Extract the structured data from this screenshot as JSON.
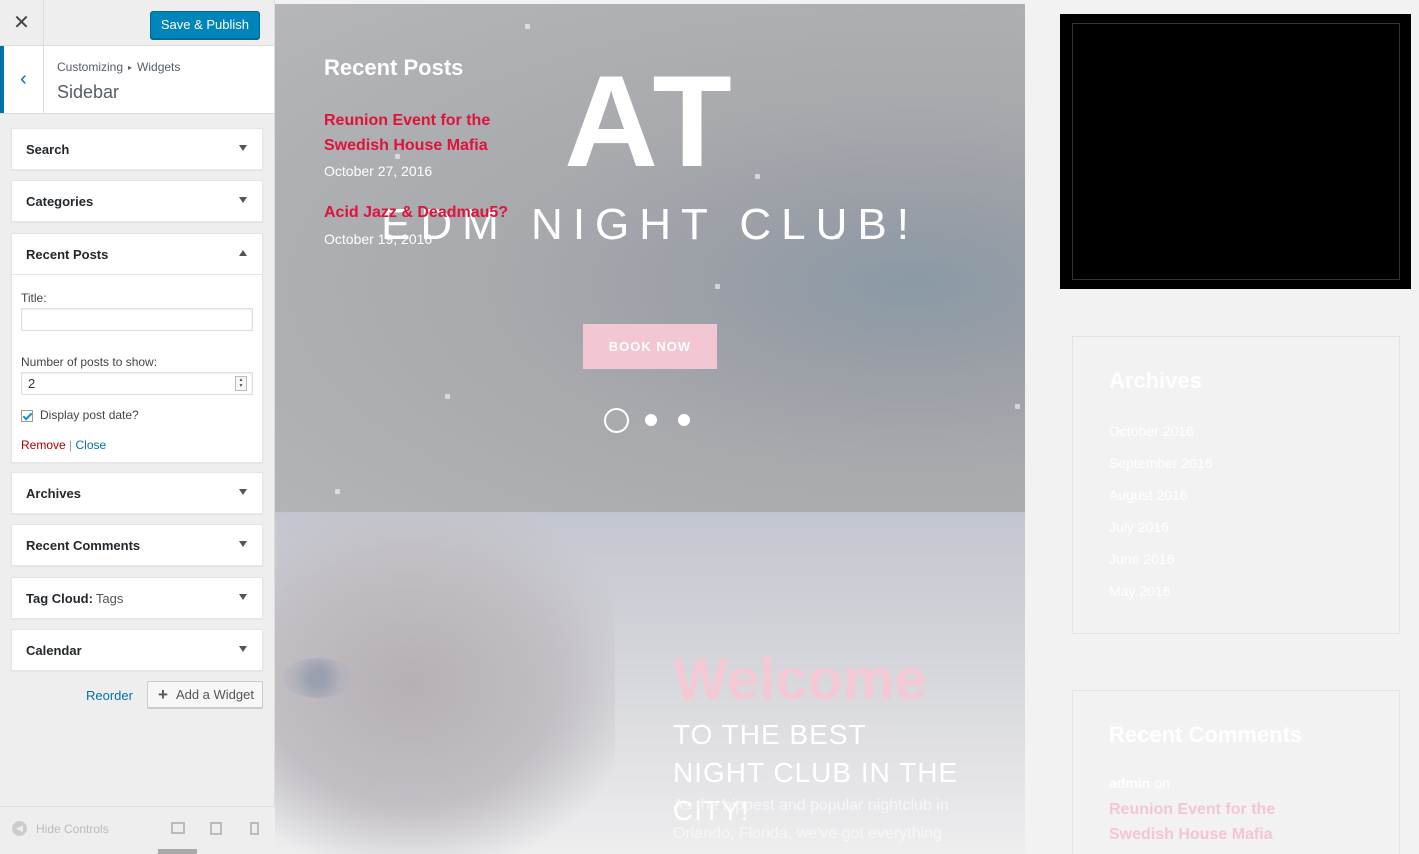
{
  "panel": {
    "close_icon": "close-icon",
    "publish_label": "Save & Publish",
    "back_icon": "chevron-left-icon",
    "breadcrumb": {
      "root": "Customizing",
      "separator": "▸",
      "current": "Widgets"
    },
    "section_title": "Sidebar",
    "widgets": [
      {
        "title": "Search",
        "sub": "",
        "expanded": false
      },
      {
        "title": "Categories",
        "sub": "",
        "expanded": false
      },
      {
        "title": "Recent Posts",
        "sub": "",
        "expanded": true
      },
      {
        "title": "Archives",
        "sub": "",
        "expanded": false
      },
      {
        "title": "Recent Comments",
        "sub": "",
        "expanded": false
      },
      {
        "title": "Tag Cloud:",
        "sub": "Tags",
        "expanded": false
      },
      {
        "title": "Calendar",
        "sub": "",
        "expanded": false
      }
    ],
    "recent_posts_form": {
      "title_label": "Title:",
      "title_value": "",
      "number_label": "Number of posts to show:",
      "number_value": "2",
      "display_date_label": "Display post date?",
      "display_date_checked": true,
      "remove_label": "Remove",
      "divider": "|",
      "close_label": "Close"
    },
    "reorder_label": "Reorder",
    "add_widget_label": "Add a Widget",
    "hide_controls_label": "Hide Controls",
    "devices": [
      "desktop-icon",
      "tablet-icon",
      "mobile-icon"
    ]
  },
  "preview": {
    "hero_big": "AT",
    "hero_sub": "EDM NIGHT CLUB!",
    "book_label": "BOOK NOW",
    "slider_dots": 3,
    "welcome": "Welcome",
    "tagline": "TO THE BEST NIGHT CLUB IN THE CITY!",
    "intro": "As the hippest and popular nightclub in Orlando, Florida, we've got everything",
    "sidebar": {
      "recent_posts_title": "Recent Posts",
      "posts": [
        {
          "title": "Reunion Event for the Swedish House Mafia",
          "date": "October 27, 2016"
        },
        {
          "title": "Acid Jazz & Deadmau5?",
          "date": "October 19, 2016"
        }
      ],
      "archives_title": "Archives",
      "archives": [
        "October 2016",
        "September 2016",
        "August 2016",
        "July 2016",
        "June 2016",
        "May 2016"
      ],
      "recent_comments_title": "Recent Comments",
      "comment_author": "admin",
      "comment_on": "on",
      "comment_post": "Reunion Event for the Swedish House Mafia"
    },
    "colors": {
      "accent_red": "#e0123a",
      "wp_blue": "#0085ba",
      "pink": "#f3c6d3"
    }
  }
}
